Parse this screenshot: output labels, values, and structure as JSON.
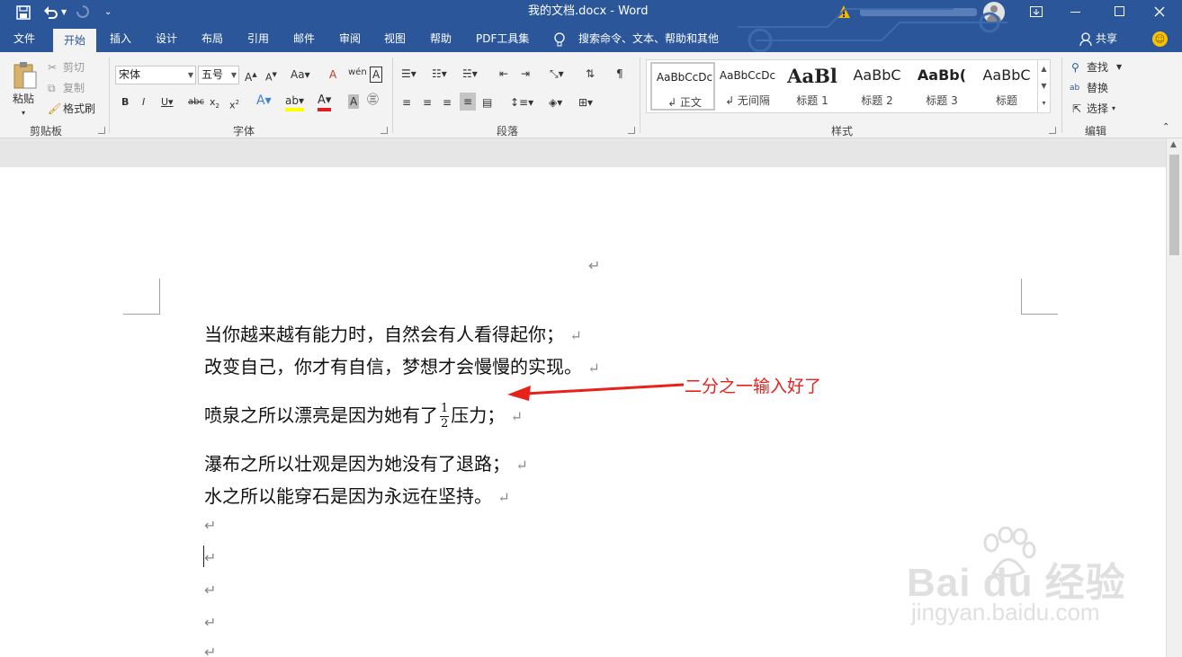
{
  "titlebar": {
    "title": "我的文档.docx  -  Word",
    "quick_access": [
      "save",
      "undo",
      "redo",
      "customize"
    ]
  },
  "tabs": {
    "file": "文件",
    "active": "开始",
    "items": [
      "插入",
      "设计",
      "布局",
      "引用",
      "邮件",
      "审阅",
      "视图",
      "帮助",
      "PDF工具集"
    ],
    "tell_me": "搜索命令、文本、帮助和其他",
    "share": "共享"
  },
  "clipboard": {
    "paste": "粘贴",
    "cut": "剪切",
    "copy": "复制",
    "format_painter": "格式刷",
    "label": "剪贴板"
  },
  "font": {
    "name": "宋体",
    "size": "五号",
    "label": "字体"
  },
  "paragraph": {
    "label": "段落"
  },
  "styles": {
    "items": [
      {
        "sample": "AaBbCcDc",
        "name": "↲ 正文"
      },
      {
        "sample": "AaBbCcDc",
        "name": "↲ 无间隔"
      },
      {
        "sample": "AaBl",
        "name": "标题 1"
      },
      {
        "sample": "AaBbC",
        "name": "标题 2"
      },
      {
        "sample": "AaBb(",
        "name": "标题 3"
      },
      {
        "sample": "AaBbC",
        "name": "标题"
      }
    ],
    "label": "样式"
  },
  "editing": {
    "find": "查找",
    "replace": "替换",
    "select": "选择",
    "label": "编辑"
  },
  "document": {
    "lines": [
      "当你越来越有能力时，自然会有人看得起你；",
      "改变自己，你才有自信，梦想才会慢慢的实现。",
      "喷泉之所以漂亮是因为她有了",
      "压力；",
      "瀑布之所以壮观是因为她没有了退路；",
      "水之所以能穿石是因为永远在坚持。"
    ],
    "fraction_numerator": "1",
    "fraction_denominator": "2",
    "para_mark": "↵"
  },
  "annotation": {
    "text": "二分之一输入好了",
    "color": "#e8221b"
  },
  "watermark": {
    "brand": "Bai du 经验",
    "url": "jingyan.baidu.com"
  },
  "colors": {
    "accent": "#2b579a",
    "ribbon_bg": "#f3f3f3"
  }
}
